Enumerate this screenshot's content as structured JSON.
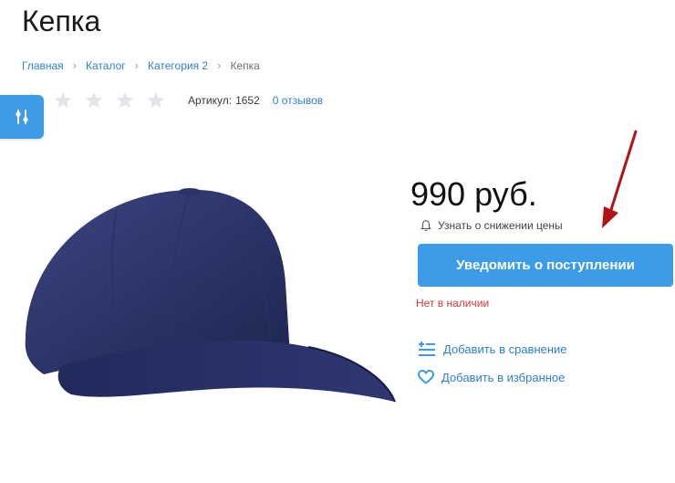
{
  "product": {
    "title": "Кепка",
    "sku_label": "Артикул:",
    "sku_value": "1652",
    "reviews_link": "0 отзывов",
    "rating": 0,
    "rating_max": 5,
    "price": "990 руб.",
    "price_alert_link": "Узнать о снижении цены",
    "notify_button": "Уведомить о поступлении",
    "stock_status": "Нет в наличии",
    "compare_link": "Добавить в сравнение",
    "favorite_link": "Добавить в избранное"
  },
  "breadcrumb": {
    "items": [
      "Главная",
      "Каталог",
      "Категория 2"
    ],
    "current": "Кепка"
  },
  "colors": {
    "accent": "#3d9ce8",
    "link": "#2f7fd1",
    "out_of_stock": "#d9373a",
    "annotation_arrow": "#b01414"
  },
  "icons": [
    "filter-sliders-icon",
    "star-icon",
    "bell-icon",
    "compare-list-icon",
    "heart-icon",
    "annotation-arrow"
  ]
}
